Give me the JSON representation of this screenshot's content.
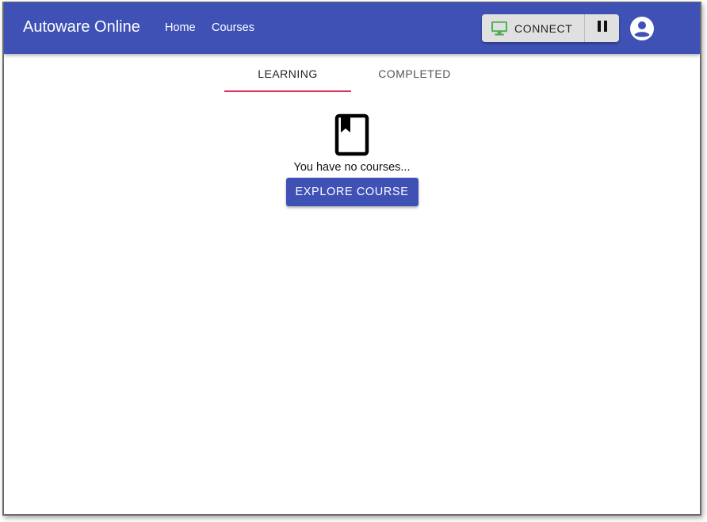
{
  "header": {
    "brand": "Autoware Online",
    "nav": [
      {
        "label": "Home"
      },
      {
        "label": "Courses"
      }
    ],
    "connect_label": "CONNECT",
    "connect_icon": "monitor-icon",
    "connect_icon_color": "#4caf50",
    "pause_icon": "pause-icon",
    "account_icon": "account-circle-icon",
    "bar_color": "#3f51b5"
  },
  "tabs": [
    {
      "label": "LEARNING",
      "active": true
    },
    {
      "label": "COMPLETED",
      "active": false
    }
  ],
  "tab_indicator_color": "#e0305a",
  "empty_state": {
    "icon": "book-icon",
    "message": "You have no courses...",
    "button_label": "EXPLORE COURSE"
  }
}
